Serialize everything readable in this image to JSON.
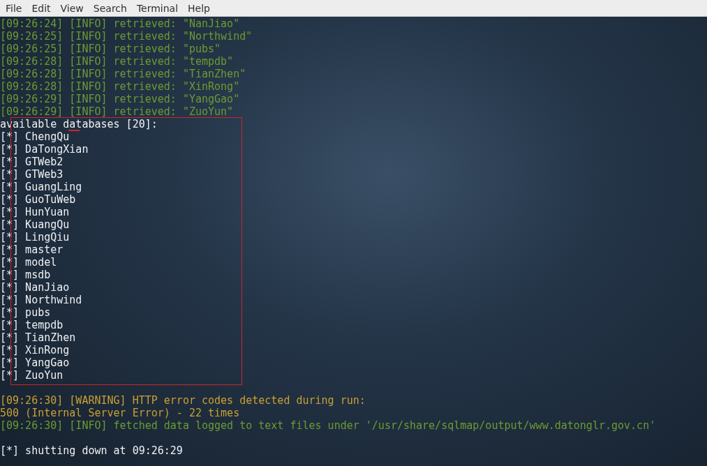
{
  "menu": [
    "File",
    "Edit",
    "View",
    "Search",
    "Terminal",
    "Help"
  ],
  "lines": [
    {
      "kind": "info",
      "text": "[09:26:24] [INFO] retrieved: \"NanJiao\""
    },
    {
      "kind": "info",
      "text": "[09:26:25] [INFO] retrieved: \"Northwind\""
    },
    {
      "kind": "info",
      "text": "[09:26:25] [INFO] retrieved: \"pubs\""
    },
    {
      "kind": "info",
      "text": "[09:26:28] [INFO] retrieved: \"tempdb\""
    },
    {
      "kind": "info",
      "text": "[09:26:28] [INFO] retrieved: \"TianZhen\""
    },
    {
      "kind": "info",
      "text": "[09:26:28] [INFO] retrieved: \"XinRong\""
    },
    {
      "kind": "info",
      "text": "[09:26:29] [INFO] retrieved: \"YangGao\""
    },
    {
      "kind": "info",
      "text": "[09:26:29] [INFO] retrieved: \"ZuoYun\""
    },
    {
      "kind": "plain",
      "text": "available databases [20]:"
    },
    {
      "kind": "plain",
      "text": "[*] ChengQu"
    },
    {
      "kind": "plain",
      "text": "[*] DaTongXian"
    },
    {
      "kind": "plain",
      "text": "[*] GTWeb2"
    },
    {
      "kind": "plain",
      "text": "[*] GTWeb3"
    },
    {
      "kind": "plain",
      "text": "[*] GuangLing"
    },
    {
      "kind": "plain",
      "text": "[*] GuoTuWeb"
    },
    {
      "kind": "plain",
      "text": "[*] HunYuan"
    },
    {
      "kind": "plain",
      "text": "[*] KuangQu"
    },
    {
      "kind": "plain",
      "text": "[*] LingQiu"
    },
    {
      "kind": "plain",
      "text": "[*] master"
    },
    {
      "kind": "plain",
      "text": "[*] model"
    },
    {
      "kind": "plain",
      "text": "[*] msdb"
    },
    {
      "kind": "plain",
      "text": "[*] NanJiao"
    },
    {
      "kind": "plain",
      "text": "[*] Northwind"
    },
    {
      "kind": "plain",
      "text": "[*] pubs"
    },
    {
      "kind": "plain",
      "text": "[*] tempdb"
    },
    {
      "kind": "plain",
      "text": "[*] TianZhen"
    },
    {
      "kind": "plain",
      "text": "[*] XinRong"
    },
    {
      "kind": "plain",
      "text": "[*] YangGao"
    },
    {
      "kind": "plain",
      "text": "[*] ZuoYun"
    },
    {
      "kind": "blank"
    },
    {
      "kind": "warning",
      "text": "[09:26:30] [WARNING] HTTP error codes detected during run:"
    },
    {
      "kind": "warning",
      "text": "500 (Internal Server Error) - 22 times"
    },
    {
      "kind": "info",
      "text": "[09:26:30] [INFO] fetched data logged to text files under '/usr/share/sqlmap/output/www.datonglr.gov.cn'"
    },
    {
      "kind": "blank"
    },
    {
      "kind": "plain",
      "text": "[*] shutting down at 09:26:29"
    }
  ]
}
